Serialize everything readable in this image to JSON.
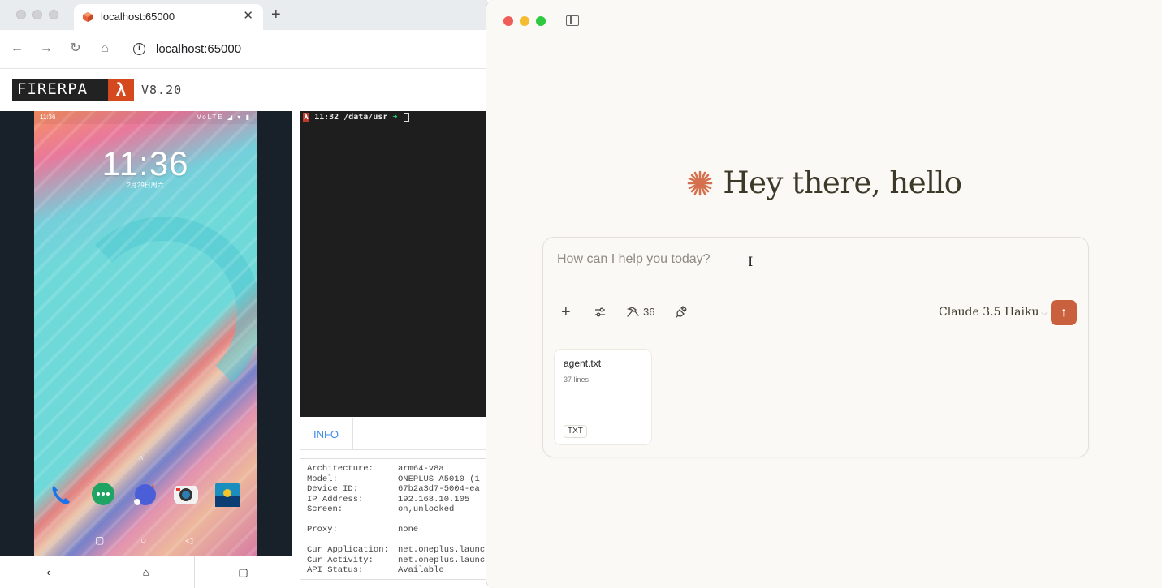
{
  "browser": {
    "tab_title": "localhost:65000",
    "tab_close": "✕",
    "new_tab": "+",
    "url": "localhost:65000",
    "nav": {
      "back": "←",
      "forward": "→",
      "reload": "↻",
      "home": "⌂"
    }
  },
  "firerpa": {
    "logo_text": "FIRERPA",
    "logo_symbol": "λ",
    "version": "V8.20"
  },
  "phone": {
    "status_time": "11:36",
    "status_icons": "VoLTE ◢ ▾ ▮",
    "lock_time": "11:36",
    "lock_date": "2月29日周六",
    "up_caret": "^",
    "nav_recent": "▢",
    "nav_home": "○",
    "nav_back": "◁",
    "dock_icons": [
      "phone-icon",
      "messages-icon",
      "browser-icon",
      "camera-icon",
      "gallery-icon"
    ],
    "controls": {
      "back": "‹",
      "home": "⌂",
      "overview": "▢"
    }
  },
  "terminal": {
    "prompt_symbol": "λ",
    "prompt_time": "11:32",
    "prompt_path": "/data/usr",
    "prompt_arrow": "➜"
  },
  "info": {
    "tab_label": "INFO",
    "rows": [
      {
        "key": "Architecture:",
        "value": "arm64-v8a"
      },
      {
        "key": "Model:",
        "value": "ONEPLUS A5010 (1"
      },
      {
        "key": "Device ID:",
        "value": "67b2a3d7-5004-ea"
      },
      {
        "key": "IP Address:",
        "value": "192.168.10.105"
      },
      {
        "key": "Screen:",
        "value": "on,unlocked"
      },
      {
        "key": "",
        "value": ""
      },
      {
        "key": "Proxy:",
        "value": "none"
      },
      {
        "key": "",
        "value": ""
      },
      {
        "key": "Cur Application:",
        "value": "net.oneplus.launc"
      },
      {
        "key": "Cur Activity:",
        "value": "net.oneplus.launc"
      },
      {
        "key": "API Status:",
        "value": "Available"
      }
    ]
  },
  "app": {
    "greeting": "Hey there, hello",
    "composer": {
      "placeholder": "How can I help you today?",
      "add": "+",
      "tools_count": "36",
      "model": "Claude 3.5 Haiku",
      "send": "↑"
    },
    "attachment": {
      "name": "agent.txt",
      "lines": "37 lines",
      "type": "TXT"
    }
  },
  "colors": {
    "accent": "#c9613f",
    "traffic_red": "#ee5e57",
    "traffic_yellow": "#f6bc2f",
    "traffic_green": "#2fc841",
    "info_tab": "#3d8ee8"
  }
}
